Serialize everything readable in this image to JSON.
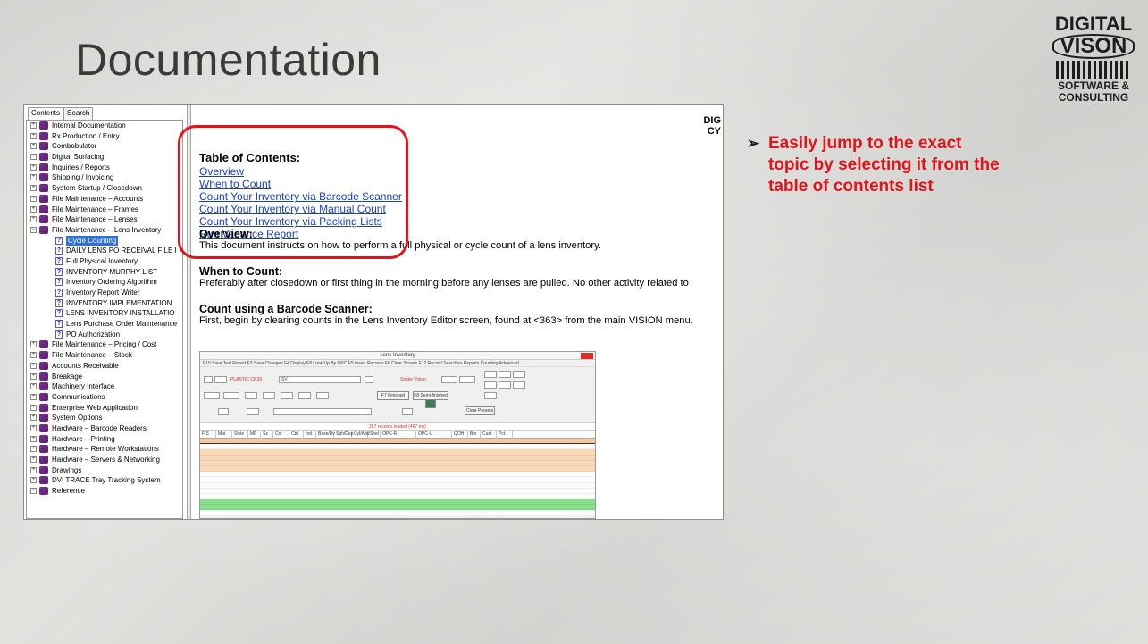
{
  "slide": {
    "title": "Documentation",
    "logo": {
      "line1": "DIGITAL",
      "line2": "VISON",
      "line3a": "SOFTWARE &",
      "line3b": "CONSULTING"
    },
    "bullet": "Easily jump to the exact topic by selecting it from the table of contents list"
  },
  "help_window": {
    "tabs": [
      "Contents",
      "Search"
    ],
    "tree": [
      {
        "label": "Internal Documentation",
        "level": 0,
        "kind": "book"
      },
      {
        "label": "Rx Production / Entry",
        "level": 0,
        "kind": "book"
      },
      {
        "label": "Combobulator",
        "level": 0,
        "kind": "book"
      },
      {
        "label": "Digital Surfacing",
        "level": 0,
        "kind": "book"
      },
      {
        "label": "Inquiries / Reports",
        "level": 0,
        "kind": "book"
      },
      {
        "label": "Shipping / Invoicing",
        "level": 0,
        "kind": "book"
      },
      {
        "label": "System Startup / Closedown",
        "level": 0,
        "kind": "book"
      },
      {
        "label": "File Maintenance – Accounts",
        "level": 0,
        "kind": "book"
      },
      {
        "label": "File Maintenance – Frames",
        "level": 0,
        "kind": "book"
      },
      {
        "label": "File Maintenance – Lenses",
        "level": 0,
        "kind": "book"
      },
      {
        "label": "File Maintenance – Lens Inventory",
        "level": 0,
        "kind": "book-open"
      },
      {
        "label": "Cycle Counting",
        "level": 1,
        "kind": "doc",
        "selected": true
      },
      {
        "label": "DAILY LENS PO RECEIVAL FILE I",
        "level": 1,
        "kind": "doc"
      },
      {
        "label": "Full Physical Inventory",
        "level": 1,
        "kind": "doc"
      },
      {
        "label": "INVENTORY MURPHY LIST",
        "level": 1,
        "kind": "doc"
      },
      {
        "label": "Inventory Ordering Algorithm",
        "level": 1,
        "kind": "doc"
      },
      {
        "label": "Inventory Report Writer",
        "level": 1,
        "kind": "doc"
      },
      {
        "label": "INVENTORY IMPLEMENTATION",
        "level": 1,
        "kind": "doc"
      },
      {
        "label": "LENS INVENTORY INSTALLATIO",
        "level": 1,
        "kind": "doc"
      },
      {
        "label": "Lens Purchase Order Maintenance",
        "level": 1,
        "kind": "doc"
      },
      {
        "label": "PO Authorization",
        "level": 1,
        "kind": "doc"
      },
      {
        "label": "File Maintenance – Pricing / Cost",
        "level": 0,
        "kind": "book"
      },
      {
        "label": "File Maintenance – Stock",
        "level": 0,
        "kind": "book"
      },
      {
        "label": "Accounts Receivable",
        "level": 0,
        "kind": "book"
      },
      {
        "label": "Breakage",
        "level": 0,
        "kind": "book"
      },
      {
        "label": "Machinery Interface",
        "level": 0,
        "kind": "book"
      },
      {
        "label": "Communications",
        "level": 0,
        "kind": "book"
      },
      {
        "label": "Enterprise Web Application",
        "level": 0,
        "kind": "book"
      },
      {
        "label": "System Options",
        "level": 0,
        "kind": "book"
      },
      {
        "label": "Hardware – Barcode Readers",
        "level": 0,
        "kind": "book"
      },
      {
        "label": "Hardware – Printing",
        "level": 0,
        "kind": "book"
      },
      {
        "label": "Hardware – Remote Workstations",
        "level": 0,
        "kind": "book"
      },
      {
        "label": "Hardware – Servers & Networking",
        "level": 0,
        "kind": "book"
      },
      {
        "label": "Drawings",
        "level": 0,
        "kind": "book"
      },
      {
        "label": "DVI TRACE Tray Tracking System",
        "level": 0,
        "kind": "book"
      },
      {
        "label": "Reference",
        "level": 0,
        "kind": "book"
      }
    ],
    "content": {
      "header_right": [
        "DIG",
        "CY"
      ],
      "toc_title": "Table of Contents:",
      "toc_links": [
        "Overview",
        "When to Count",
        "Count Your Inventory via Barcode Scanner",
        "Count Your Inventory via Manual Count",
        "Count Your Inventory via Packing Lists",
        "Run Variance Report"
      ],
      "overview_heading": "Overview:",
      "overview_text": "This document instructs on how to perform a full physical or cycle count of a lens inventory.",
      "when_heading": "When to Count:",
      "when_text": "Preferably after closedown or first thing in the morning before any lenses are pulled.  No other activity related to",
      "barcode_heading": "Count using a Barcode Scanner:",
      "barcode_text": "First, begin by clearing counts in the Lens Inventory Editor screen, found at <363> from the main VISION menu."
    },
    "inventory_screen": {
      "title": "Lens Inventory",
      "menu": "F10 Save Text Report   F3 Save Changes   F4 Display   F8 Look Up By OPC   F5 Insert Records   F6 Clear Screen   F12 Record Searches   Reports   Counting   Advanced",
      "material_value": "PLASTIC CR39",
      "style_value": "SV",
      "type_value": "Single Vision",
      "btn_finished": "F7 Finished",
      "btn_semi": "F8 Semi-finished",
      "btn_clear": "Clear Presets",
      "status": "357 records loaded (467 ms)",
      "columns": [
        "F/S",
        "Mat",
        "Style",
        "MF",
        "Sz",
        "Col",
        "Ctd",
        "Ind",
        "Base/Dv",
        "Sph/Dep",
        "Cyl/Add",
        "Shel",
        "OPC-R",
        "OPC-L",
        "QOH",
        "Bin",
        "Cust",
        "Pct"
      ]
    }
  }
}
